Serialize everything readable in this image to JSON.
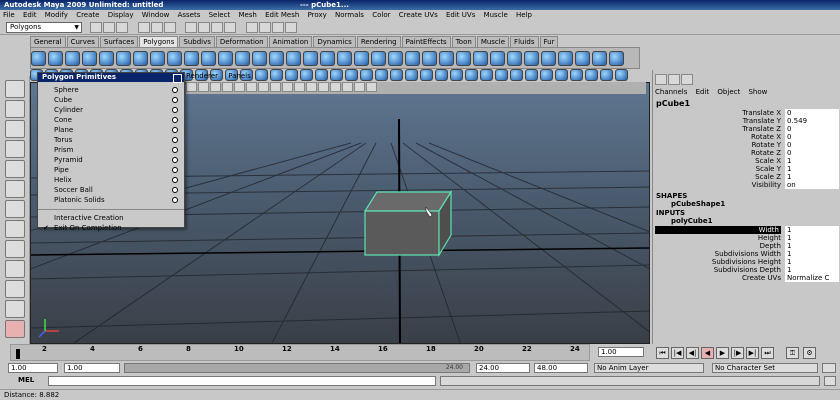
{
  "window": {
    "title": "Autodesk Maya 2009 Unlimited: untitled",
    "separator": "---",
    "object": "pCube1..."
  },
  "menubar": [
    "File",
    "Edit",
    "Modify",
    "Create",
    "Display",
    "Window",
    "Assets",
    "Select",
    "Mesh",
    "Edit Mesh",
    "Proxy",
    "Normals",
    "Color",
    "Create UVs",
    "Edit UVs",
    "Muscle",
    "Help"
  ],
  "statusline": {
    "mode": "Polygons"
  },
  "shelf_tabs": [
    "General",
    "Curves",
    "Surfaces",
    "Polygons",
    "Subdivs",
    "Deformation",
    "Animation",
    "Dynamics",
    "Rendering",
    "PaintEffects",
    "Toon",
    "Muscle",
    "Fluids",
    "Fur"
  ],
  "shelf_active": "Polygons",
  "viewport_menu": [
    "Renderer",
    "Panels"
  ],
  "popup": {
    "title": "Polygon Primitives",
    "items": [
      "Sphere",
      "Cube",
      "Cylinder",
      "Cone",
      "Plane",
      "Torus",
      "Prism",
      "Pyramid",
      "Pipe",
      "Helix",
      "Soccer Ball",
      "Platonic Solids"
    ],
    "extra": [
      "Interactive Creation",
      "Exit On Completion"
    ],
    "checked_extra": "Exit On Completion"
  },
  "channel_box": {
    "menu": [
      "Channels",
      "Edit",
      "Object",
      "Show"
    ],
    "object": "pCube1",
    "attributes": [
      {
        "label": "Translate X",
        "value": "0"
      },
      {
        "label": "Translate Y",
        "value": "0.549"
      },
      {
        "label": "Translate Z",
        "value": "0"
      },
      {
        "label": "Rotate X",
        "value": "0"
      },
      {
        "label": "Rotate Y",
        "value": "0"
      },
      {
        "label": "Rotate Z",
        "value": "0"
      },
      {
        "label": "Scale X",
        "value": "1"
      },
      {
        "label": "Scale Y",
        "value": "1"
      },
      {
        "label": "Scale Z",
        "value": "1"
      },
      {
        "label": "Visibility",
        "value": "on"
      }
    ],
    "shapes_header": "SHAPES",
    "shape": "pCubeShape1",
    "inputs_header": "INPUTS",
    "input": "polyCube1",
    "input_attributes": [
      {
        "label": "Width",
        "value": "1"
      },
      {
        "label": "Height",
        "value": "1"
      },
      {
        "label": "Depth",
        "value": "1"
      },
      {
        "label": "Subdivisions Width",
        "value": "1"
      },
      {
        "label": "Subdivisions Height",
        "value": "1"
      },
      {
        "label": "Subdivisions Depth",
        "value": "1"
      },
      {
        "label": "Create UVs",
        "value": "Normalize C"
      }
    ]
  },
  "timeline": {
    "ticks": [
      "2",
      "4",
      "6",
      "8",
      "10",
      "12",
      "14",
      "16",
      "18",
      "20",
      "22",
      "24"
    ],
    "current_frame": "1.00"
  },
  "range": {
    "start": "1.00",
    "playback_start": "1.00",
    "range_end_inner": "24.00",
    "playback_end": "24.00",
    "end": "48.00",
    "anim_layer": "No Anim Layer",
    "character_set": "No Character Set"
  },
  "mel_label": "MEL",
  "help_line": "Distance: 8.882",
  "colors": {
    "title": "#0a246a",
    "cube_highlight": "#5fe0b0"
  }
}
